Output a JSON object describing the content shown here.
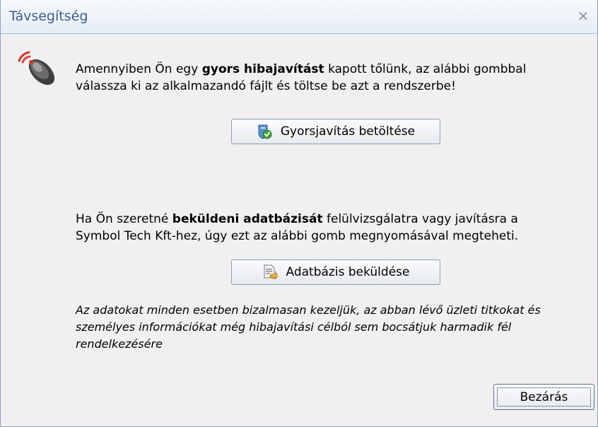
{
  "window": {
    "title": "Távsegítség"
  },
  "hotfix": {
    "text_before": "Amennyiben Ön egy ",
    "text_bold": "gyors hibajavítást",
    "text_after": " kapott tőlünk, az alábbi gombbal",
    "line2": "válassza ki az alkalmazandó fájlt és töltse be azt a rendszerbe!",
    "button_label": "Gyorsjavítás betöltése",
    "button_icon": "shield-check-icon"
  },
  "database": {
    "text_before": "Ha Ön szeretné ",
    "text_bold": "beküldeni adatbázisát",
    "text_after": " felülvizsgálatra vagy javításra a",
    "line2": "Symbol Tech Kft-hez, úgy ezt az alábbi gomb megnyomásával megteheti.",
    "button_label": "Adatbázis beküldése",
    "button_icon": "database-send-icon"
  },
  "privacy_note": "Az adatokat minden esetben bizalmasan kezeljük, az abban lévő üzleti titkokat és személyes információkat még hibajavítási célból sem bocsátjuk harmadik fél rendelkezésére",
  "footer": {
    "close_label": "Bezárás"
  },
  "colors": {
    "title_text": "#3b5d92",
    "border": "#8aa3c3",
    "background": "#f0f0f0"
  }
}
